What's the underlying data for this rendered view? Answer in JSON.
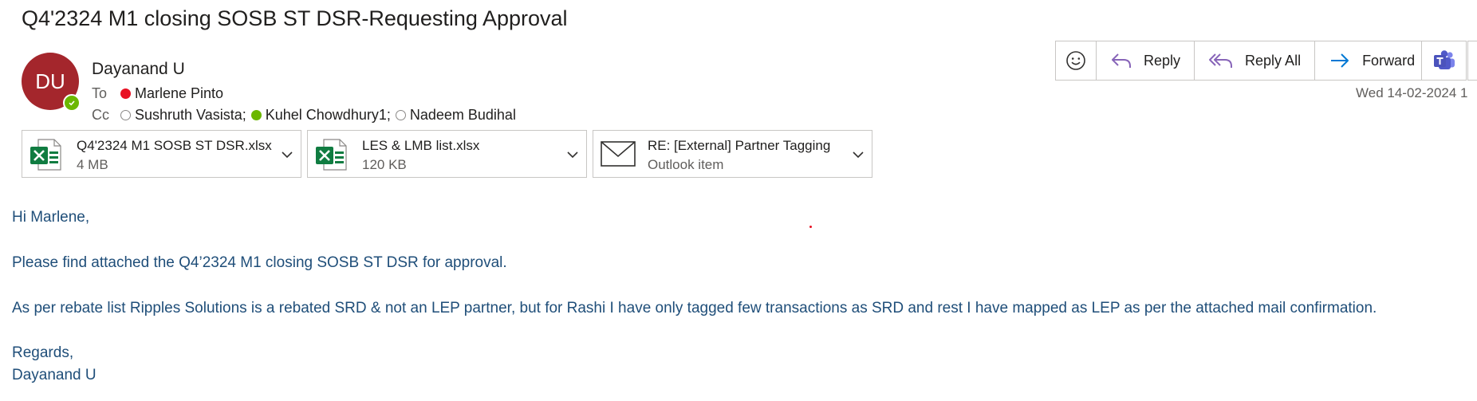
{
  "email": {
    "subject": "Q4'2324 M1 closing SOSB ST DSR-Requesting Approval",
    "sender": {
      "initials": "DU",
      "name": "Dayanand U",
      "avatar_color": "#a4262c",
      "presence": "available"
    },
    "to_label": "To",
    "cc_label": "Cc",
    "to": [
      {
        "name": "Marlene Pinto",
        "status": "busy"
      }
    ],
    "cc": [
      {
        "name": "Sushruth Vasista;",
        "status": "offline"
      },
      {
        "name": "Kuhel Chowdhury1;",
        "status": "available"
      },
      {
        "name": "Nadeem Budihal",
        "status": "offline"
      }
    ],
    "timestamp": "Wed 14-02-2024 1"
  },
  "toolbar": {
    "emoji_icon": "smiley-icon",
    "reply_label": "Reply",
    "reply_all_label": "Reply All",
    "forward_label": "Forward",
    "teams_icon": "teams-icon",
    "accent_color": "#8764b8",
    "forward_color": "#0078d4"
  },
  "attachments": [
    {
      "name": "Q4'2324 M1 SOSB ST DSR.xlsx",
      "size": "4 MB",
      "icon": "excel-icon"
    },
    {
      "name": "LES & LMB list.xlsx",
      "size": "120 KB",
      "icon": "excel-icon"
    },
    {
      "name": "RE: [External] Partner Tagging",
      "size": "Outlook item",
      "icon": "envelope-icon"
    }
  ],
  "body": {
    "greeting": "Hi Marlene,",
    "para1": "Please find attached the Q4’2324 M1 closing SOSB ST DSR for approval.",
    "para2": "As per rebate list Ripples Solutions is a rebated SRD & not an LEP partner, but for Rashi I have only tagged few transactions as SRD and rest I have mapped as LEP as per the attached mail confirmation.",
    "closing": "Regards,",
    "signature": "Dayanand U",
    "text_color": "#1f4e79"
  }
}
